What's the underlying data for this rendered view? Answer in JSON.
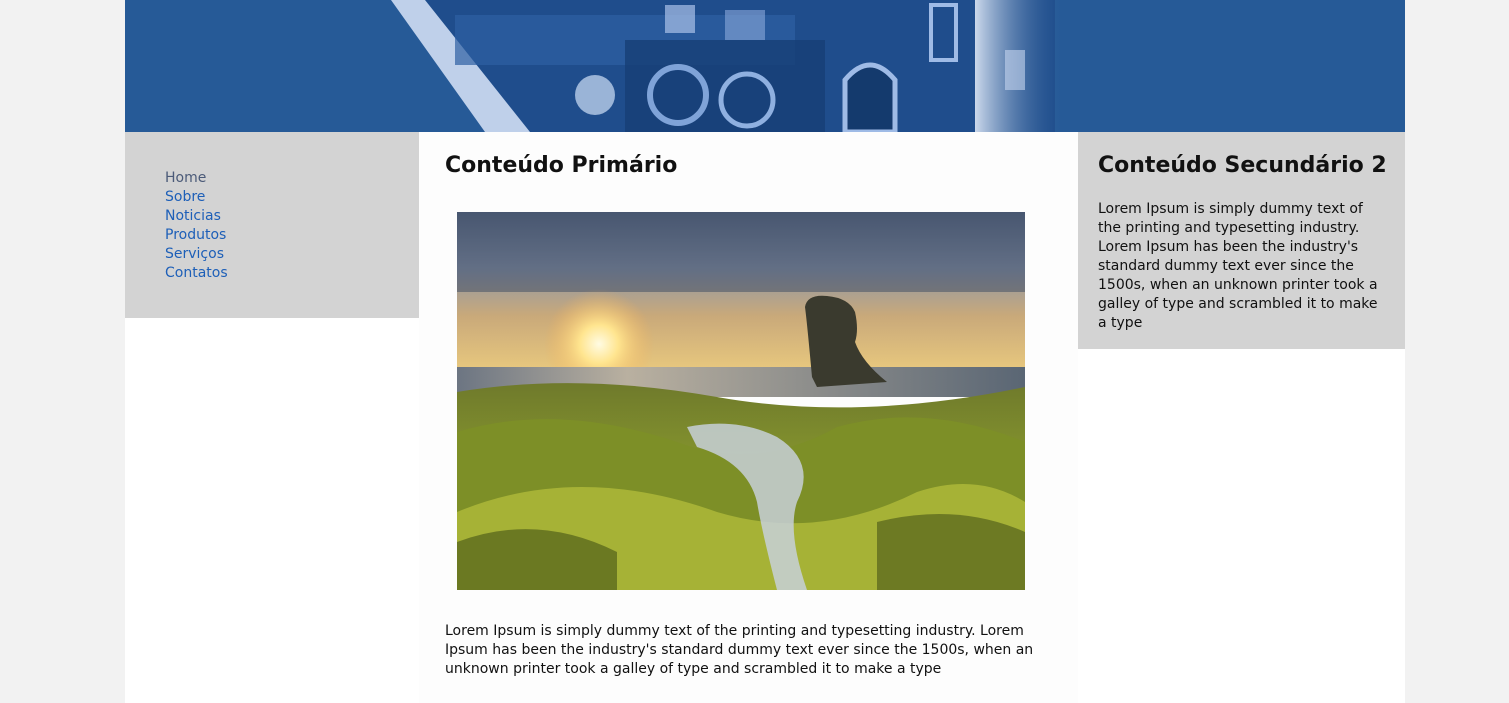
{
  "nav": {
    "items": [
      {
        "label": "Home",
        "active": true
      },
      {
        "label": "Sobre"
      },
      {
        "label": "Noticias"
      },
      {
        "label": "Produtos"
      },
      {
        "label": "Serviços"
      },
      {
        "label": "Contatos"
      }
    ]
  },
  "main": {
    "heading": "Conteúdo Primário",
    "paragraph": "Lorem Ipsum is simply dummy text of the printing and typesetting industry. Lorem Ipsum has been the industry's standard dummy text ever since the 1500s, when an unknown printer took a galley of type and scrambled it to make a type"
  },
  "secondary": {
    "heading": "Conteúdo Secundário 2",
    "paragraph": "Lorem Ipsum is simply dummy text of the printing and typesetting industry. Lorem Ipsum has been the industry's standard dummy text ever since the 1500s, when an unknown printer took a galley of type and scrambled it to make a type"
  },
  "colors": {
    "banner_blue": "#265a97",
    "panel_gray": "#d3d3d3",
    "link_blue": "#1d5fb8",
    "page_bg": "#f2f2f2"
  }
}
